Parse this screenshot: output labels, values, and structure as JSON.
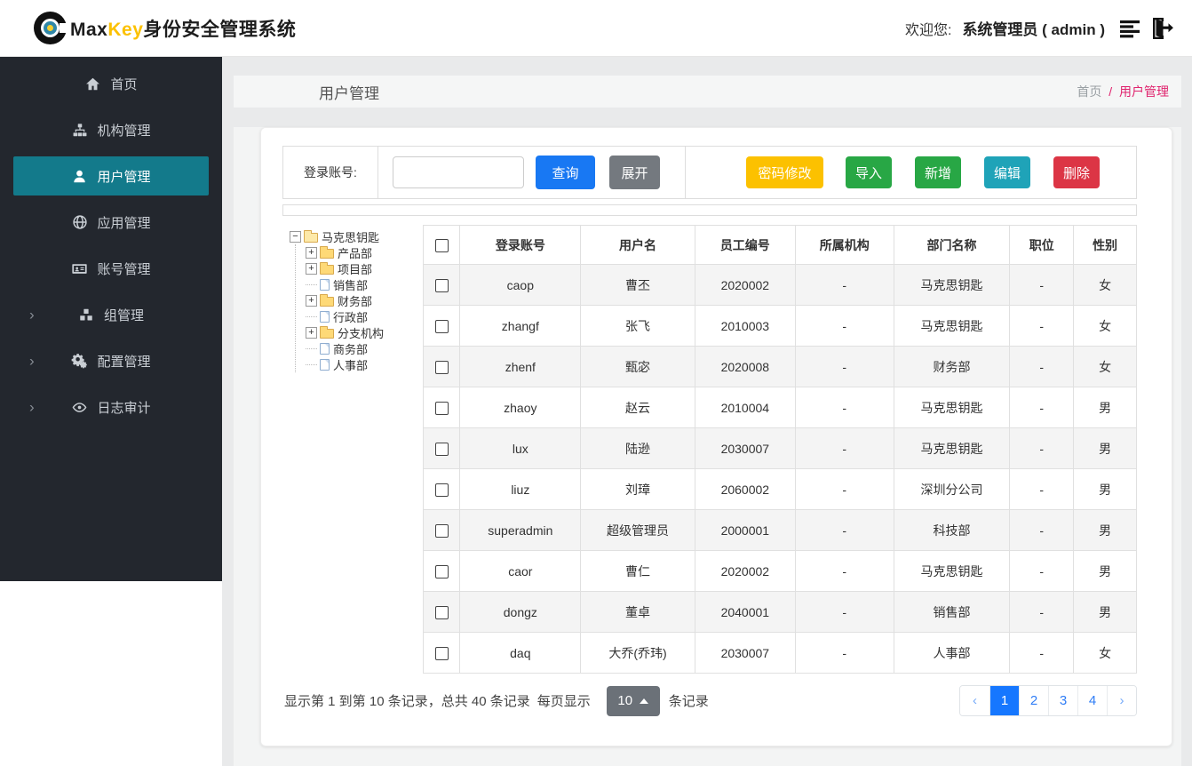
{
  "header": {
    "brand_max": "Max",
    "brand_key": "Key",
    "brand_suffix": "身份安全管理系统",
    "welcome_label": "欢迎您:",
    "user_display": "系统管理员 ( admin )"
  },
  "sidebar": {
    "chevron_glyph": "›",
    "items": [
      {
        "label": "首页",
        "icon": "home",
        "active": false,
        "expandable": false
      },
      {
        "label": "机构管理",
        "icon": "sitemap",
        "active": false,
        "expandable": false
      },
      {
        "label": "用户管理",
        "icon": "user",
        "active": true,
        "expandable": false
      },
      {
        "label": "应用管理",
        "icon": "globe",
        "active": false,
        "expandable": false
      },
      {
        "label": "账号管理",
        "icon": "id-card",
        "active": false,
        "expandable": false
      },
      {
        "label": "组管理",
        "icon": "cubes",
        "active": false,
        "expandable": true
      },
      {
        "label": "配置管理",
        "icon": "gears",
        "active": false,
        "expandable": true
      },
      {
        "label": "日志审计",
        "icon": "eye",
        "active": false,
        "expandable": true
      }
    ]
  },
  "breadcrumb": {
    "page_title": "用户管理",
    "home": "首页",
    "separator": "/",
    "current": "用户管理"
  },
  "toolbar": {
    "search_label": "登录账号:",
    "search_value": "",
    "query_label": "查询",
    "expand_label": "展开",
    "password_label": "密码修改",
    "import_label": "导入",
    "add_label": "新增",
    "edit_label": "编辑",
    "delete_label": "删除"
  },
  "tree": {
    "collapse_glyph": "−",
    "expand_glyph": "+",
    "root": "马克思钥匙",
    "children": [
      {
        "label": "产品部",
        "type": "branch"
      },
      {
        "label": "项目部",
        "type": "branch"
      },
      {
        "label": "销售部",
        "type": "leaf"
      },
      {
        "label": "财务部",
        "type": "branch"
      },
      {
        "label": "行政部",
        "type": "leaf"
      },
      {
        "label": "分支机构",
        "type": "branch"
      },
      {
        "label": "商务部",
        "type": "leaf"
      },
      {
        "label": "人事部",
        "type": "leaf"
      }
    ]
  },
  "table": {
    "columns": [
      "登录账号",
      "用户名",
      "员工编号",
      "所属机构",
      "部门名称",
      "职位",
      "性别"
    ],
    "rows": [
      {
        "login": "caop",
        "name": "曹丕",
        "emp": "2020002",
        "org": "-",
        "dept": "马克思钥匙",
        "job": "-",
        "gender": "女"
      },
      {
        "login": "zhangf",
        "name": "张飞",
        "emp": "2010003",
        "org": "-",
        "dept": "马克思钥匙",
        "job": "-",
        "gender": "女"
      },
      {
        "login": "zhenf",
        "name": "甄宓",
        "emp": "2020008",
        "org": "-",
        "dept": "财务部",
        "job": "-",
        "gender": "女"
      },
      {
        "login": "zhaoy",
        "name": "赵云",
        "emp": "2010004",
        "org": "-",
        "dept": "马克思钥匙",
        "job": "-",
        "gender": "男"
      },
      {
        "login": "lux",
        "name": "陆逊",
        "emp": "2030007",
        "org": "-",
        "dept": "马克思钥匙",
        "job": "-",
        "gender": "男"
      },
      {
        "login": "liuz",
        "name": "刘璋",
        "emp": "2060002",
        "org": "-",
        "dept": "深圳分公司",
        "job": "-",
        "gender": "男"
      },
      {
        "login": "superadmin",
        "name": "超级管理员",
        "emp": "2000001",
        "org": "-",
        "dept": "科技部",
        "job": "-",
        "gender": "男"
      },
      {
        "login": "caor",
        "name": "曹仁",
        "emp": "2020002",
        "org": "-",
        "dept": "马克思钥匙",
        "job": "-",
        "gender": "男"
      },
      {
        "login": "dongz",
        "name": "董卓",
        "emp": "2040001",
        "org": "-",
        "dept": "销售部",
        "job": "-",
        "gender": "男"
      },
      {
        "login": "daq",
        "name": "大乔(乔玮)",
        "emp": "2030007",
        "org": "-",
        "dept": "人事部",
        "job": "-",
        "gender": "女"
      }
    ]
  },
  "pagination": {
    "records_info": "显示第 1 到第 10 条记录，总共 40 条记录",
    "per_page_label": "每页显示",
    "page_size": "10",
    "per_page_suffix": "条记录",
    "prev_glyph": "‹",
    "next_glyph": "›",
    "pages": [
      "1",
      "2",
      "3",
      "4"
    ],
    "active_page": "1"
  },
  "colors": {
    "brand_yellow": "#fcc100",
    "sidebar_bg": "#23272e",
    "sidebar_active_teal": "#137a8b",
    "primary_blue": "#1878f3",
    "secondary_gray": "#74797f",
    "success_green": "#28a745",
    "info_teal": "#1fa3b8",
    "danger_red": "#dc3545",
    "breadcrumb_pink": "#e0246e",
    "pagination_active_blue": "#1677ff"
  }
}
